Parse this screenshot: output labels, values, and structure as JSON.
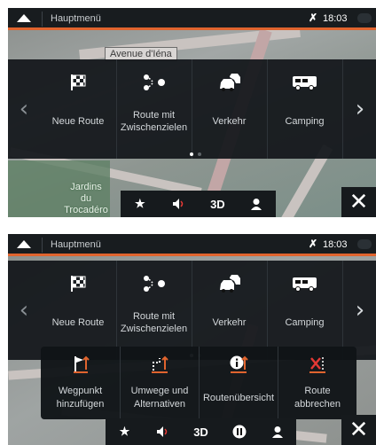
{
  "status": {
    "title": "Hauptmenü",
    "time": "18:03",
    "gps_symbol": "✗"
  },
  "map": {
    "street": "Avenue d'Iéna",
    "park": [
      "Jardins",
      "du",
      "Trocadéro"
    ]
  },
  "menu": {
    "items": [
      {
        "label": "Neue Route",
        "icon": "checkered-flag-icon"
      },
      {
        "label_lines": [
          "Route mit",
          "Zwischenzielen"
        ],
        "icon": "waypoints-route-icon"
      },
      {
        "label": "Verkehr",
        "icon": "traffic-car-icon"
      },
      {
        "label": "Camping",
        "icon": "camper-van-icon"
      }
    ],
    "prev": "‹",
    "next": "›"
  },
  "toolbar": {
    "favorite": "★",
    "sound": "◀",
    "view": "3D",
    "pause": "Ⅱ",
    "profile": "●",
    "close": "✕"
  },
  "route_menu": {
    "items": [
      {
        "label_lines": [
          "Wegpunkt",
          "hinzufügen"
        ],
        "icon": "add-waypoint-icon"
      },
      {
        "label_lines": [
          "Umwege und",
          "Alternativen"
        ],
        "icon": "detour-icon"
      },
      {
        "label_lines": [
          "Routenübersicht"
        ],
        "icon": "route-overview-icon"
      },
      {
        "label_lines": [
          "Route",
          "abbrechen"
        ],
        "icon": "cancel-route-icon"
      }
    ]
  },
  "colors": {
    "accent": "#e0642e",
    "bar": "#181c1f"
  }
}
